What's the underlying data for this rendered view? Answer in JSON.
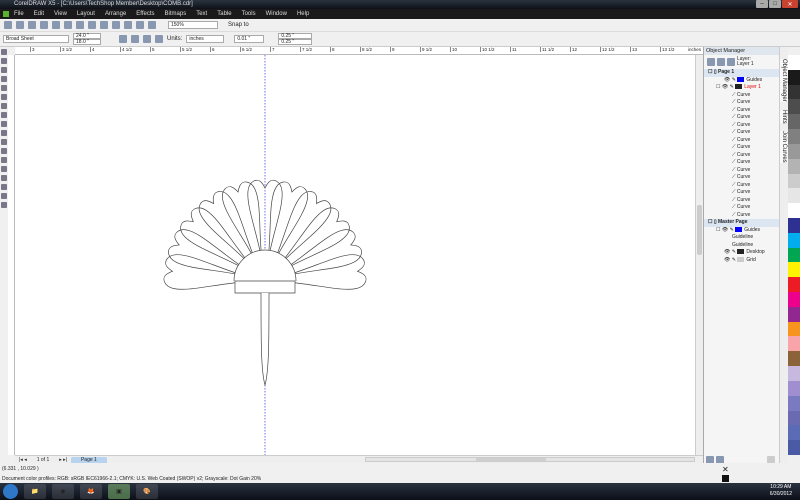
{
  "window": {
    "title": "CorelDRAW X5 - [C:\\Users\\TechShop Member\\Desktop\\COMB.cdr]",
    "min": "–",
    "max": "□",
    "close": "✕"
  },
  "menu": [
    "File",
    "Edit",
    "View",
    "Layout",
    "Arrange",
    "Effects",
    "Bitmaps",
    "Text",
    "Table",
    "Tools",
    "Window",
    "Help"
  ],
  "toolbar": {
    "zoom": "150%",
    "snap": "Snap to"
  },
  "propbar": {
    "page_size": "Broad Sheet",
    "width": "24.0 \"",
    "height": "18.0 \"",
    "units_label": "Units:",
    "units": "inches",
    "nudge": "0.01 \"",
    "dup_x": "0.25 \"",
    "dup_y": "0.25 \""
  },
  "ruler": {
    "unit": "inches",
    "labels": [
      "3",
      "3 1/2",
      "4",
      "4 1/2",
      "5",
      "5 1/2",
      "6",
      "6 1/2",
      "7",
      "7 1/2",
      "8",
      "8 1/2",
      "9",
      "9 1/2",
      "10",
      "10 1/2",
      "11",
      "11 1/2",
      "12",
      "12 1/2",
      "13",
      "13 1/2"
    ]
  },
  "object_manager": {
    "title": "Object Manager",
    "layer_label": "Layer:",
    "layer_value": "Layer 1",
    "page1": "Page 1",
    "page1_guides": "Guides",
    "layer1": "Layer 1",
    "curves": [
      "Curve",
      "Curve",
      "Curve",
      "Curve",
      "Curve",
      "Curve",
      "Curve",
      "Curve",
      "Curve",
      "Curve",
      "Curve",
      "Curve",
      "Curve",
      "Curve",
      "Curve",
      "Curve",
      "Curve"
    ],
    "master": "Master Page",
    "master_guides": "Guides",
    "guidelines": [
      "Guideline",
      "Guideline"
    ],
    "desktop": "Desktop",
    "grid": "Grid"
  },
  "side_tabs": [
    "Object Manager",
    "Hints",
    "Join Curves"
  ],
  "palette": [
    "#ffffff",
    "#1a1a1a",
    "#333333",
    "#4d4d4d",
    "#666666",
    "#808080",
    "#999999",
    "#b3b3b3",
    "#cccccc",
    "#e6e6e6",
    "#ffffff",
    "#2e3192",
    "#00aeef",
    "#00a651",
    "#fff200",
    "#ed1c24",
    "#ec008c",
    "#92278f",
    "#f7941d",
    "#f9a4a8",
    "#8c6239",
    "#c7b8e0",
    "#9f8fd0",
    "#7a7ac0",
    "#6a6ab0",
    "#5b6bb5",
    "#4a5aa5"
  ],
  "pager": {
    "count": "1 of 1",
    "tab": "Page 1"
  },
  "status": {
    "coords": "(6.331 , 10.029 )",
    "profiles": "Document color profiles: RGB: sRGB IEC61966-2.1; CMYK: U.S. Web Coated (SWOP) v2; Grayscale: Dot Gain 20%"
  },
  "taskbar": {
    "time": "10:29 AM",
    "date": "6/30/2012"
  },
  "colors": {
    "guide": "#4a4ae0",
    "layer_red": "#e00000",
    "guides_blue": "#0000ff"
  }
}
